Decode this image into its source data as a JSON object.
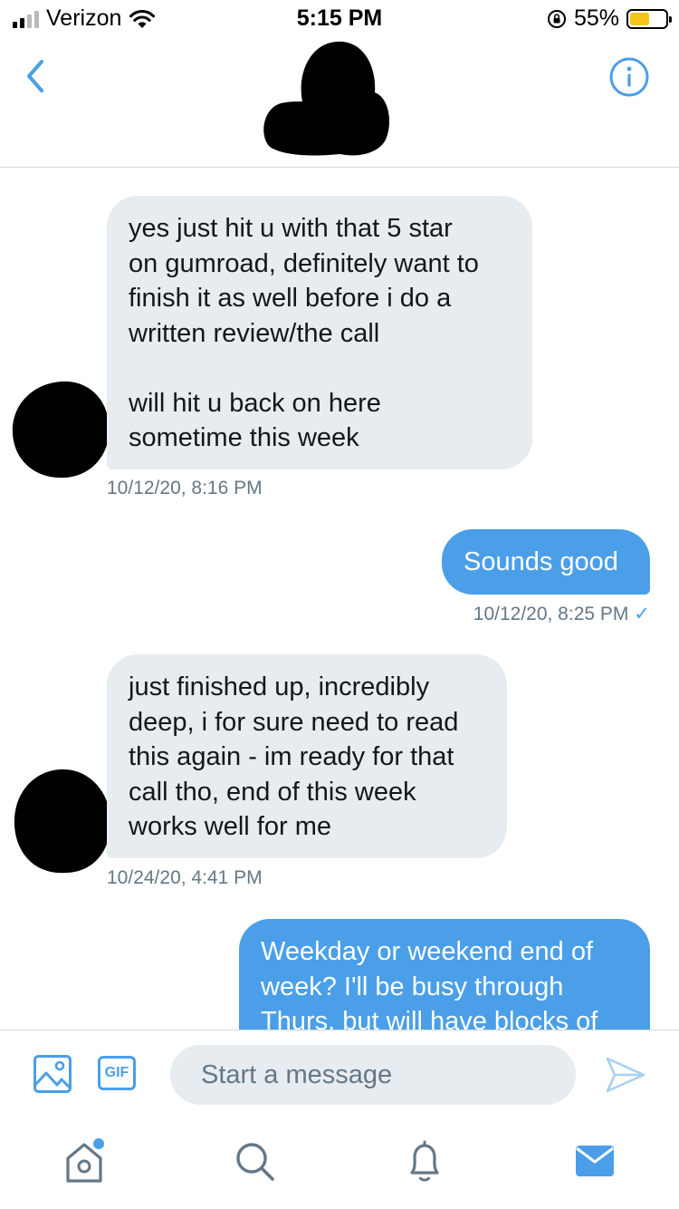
{
  "status_bar": {
    "carrier": "Verizon",
    "time": "5:15 PM",
    "battery_percent": "55%",
    "battery_level": 0.55,
    "battery_color": "#f5c518"
  },
  "header": {
    "back_icon": "chevron-left-icon",
    "info_icon": "info-icon"
  },
  "conversation": {
    "messages": [
      {
        "direction": "incoming",
        "text": "yes just hit u with that 5 star\non gumroad, definitely want to\nfinish it as well before i do a\nwritten review/the call\n\nwill hit u back on here\nsometime this week",
        "timestamp": "10/12/20, 8:16 PM"
      },
      {
        "direction": "outgoing",
        "text": "Sounds good",
        "timestamp": "10/12/20, 8:25 PM",
        "read_receipt": "✓"
      },
      {
        "direction": "incoming",
        "text": "just finished up, incredibly\ndeep, i for sure need to read\nthis again - im ready for that\ncall tho, end of this week\nworks well for me",
        "timestamp": "10/24/20, 4:41 PM"
      },
      {
        "direction": "outgoing",
        "text": "Weekday or weekend end of\nweek? I'll be busy through\nThurs, but will have blocks of"
      }
    ]
  },
  "composer": {
    "media_icon": "image-icon",
    "gif_label": "GIF",
    "placeholder": "Start a message",
    "send_icon": "send-icon"
  },
  "tab_bar": {
    "items": [
      {
        "name": "home",
        "icon": "home-icon",
        "has_notification_dot": true
      },
      {
        "name": "search",
        "icon": "search-icon"
      },
      {
        "name": "notifications",
        "icon": "bell-icon"
      },
      {
        "name": "messages",
        "icon": "mail-icon",
        "active": true
      }
    ]
  },
  "colors": {
    "accent": "#4a9fe8",
    "incoming_bubble": "#e6ecf0",
    "timestamp": "#657786"
  }
}
